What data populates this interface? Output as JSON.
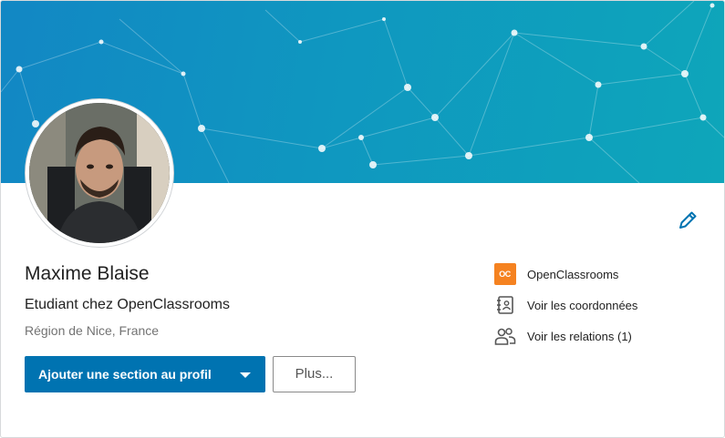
{
  "profile": {
    "name": "Maxime Blaise",
    "headline": "Etudiant chez OpenClassrooms",
    "location": "Région de Nice, France"
  },
  "actions": {
    "primary_label": "Ajouter une section au profil",
    "more_label": "Plus..."
  },
  "sidebar": {
    "items": [
      {
        "label": "OpenClassrooms",
        "icon": "company-logo-icon",
        "logo_text": "OC"
      },
      {
        "label": "Voir les coordonnées",
        "icon": "contact-book-icon"
      },
      {
        "label": "Voir les relations (1)",
        "icon": "people-icon"
      }
    ]
  },
  "colors": {
    "banner_start": "#1287c4",
    "banner_end": "#0ea6ba",
    "primary": "#0073b1",
    "company_logo": "#f58220"
  }
}
